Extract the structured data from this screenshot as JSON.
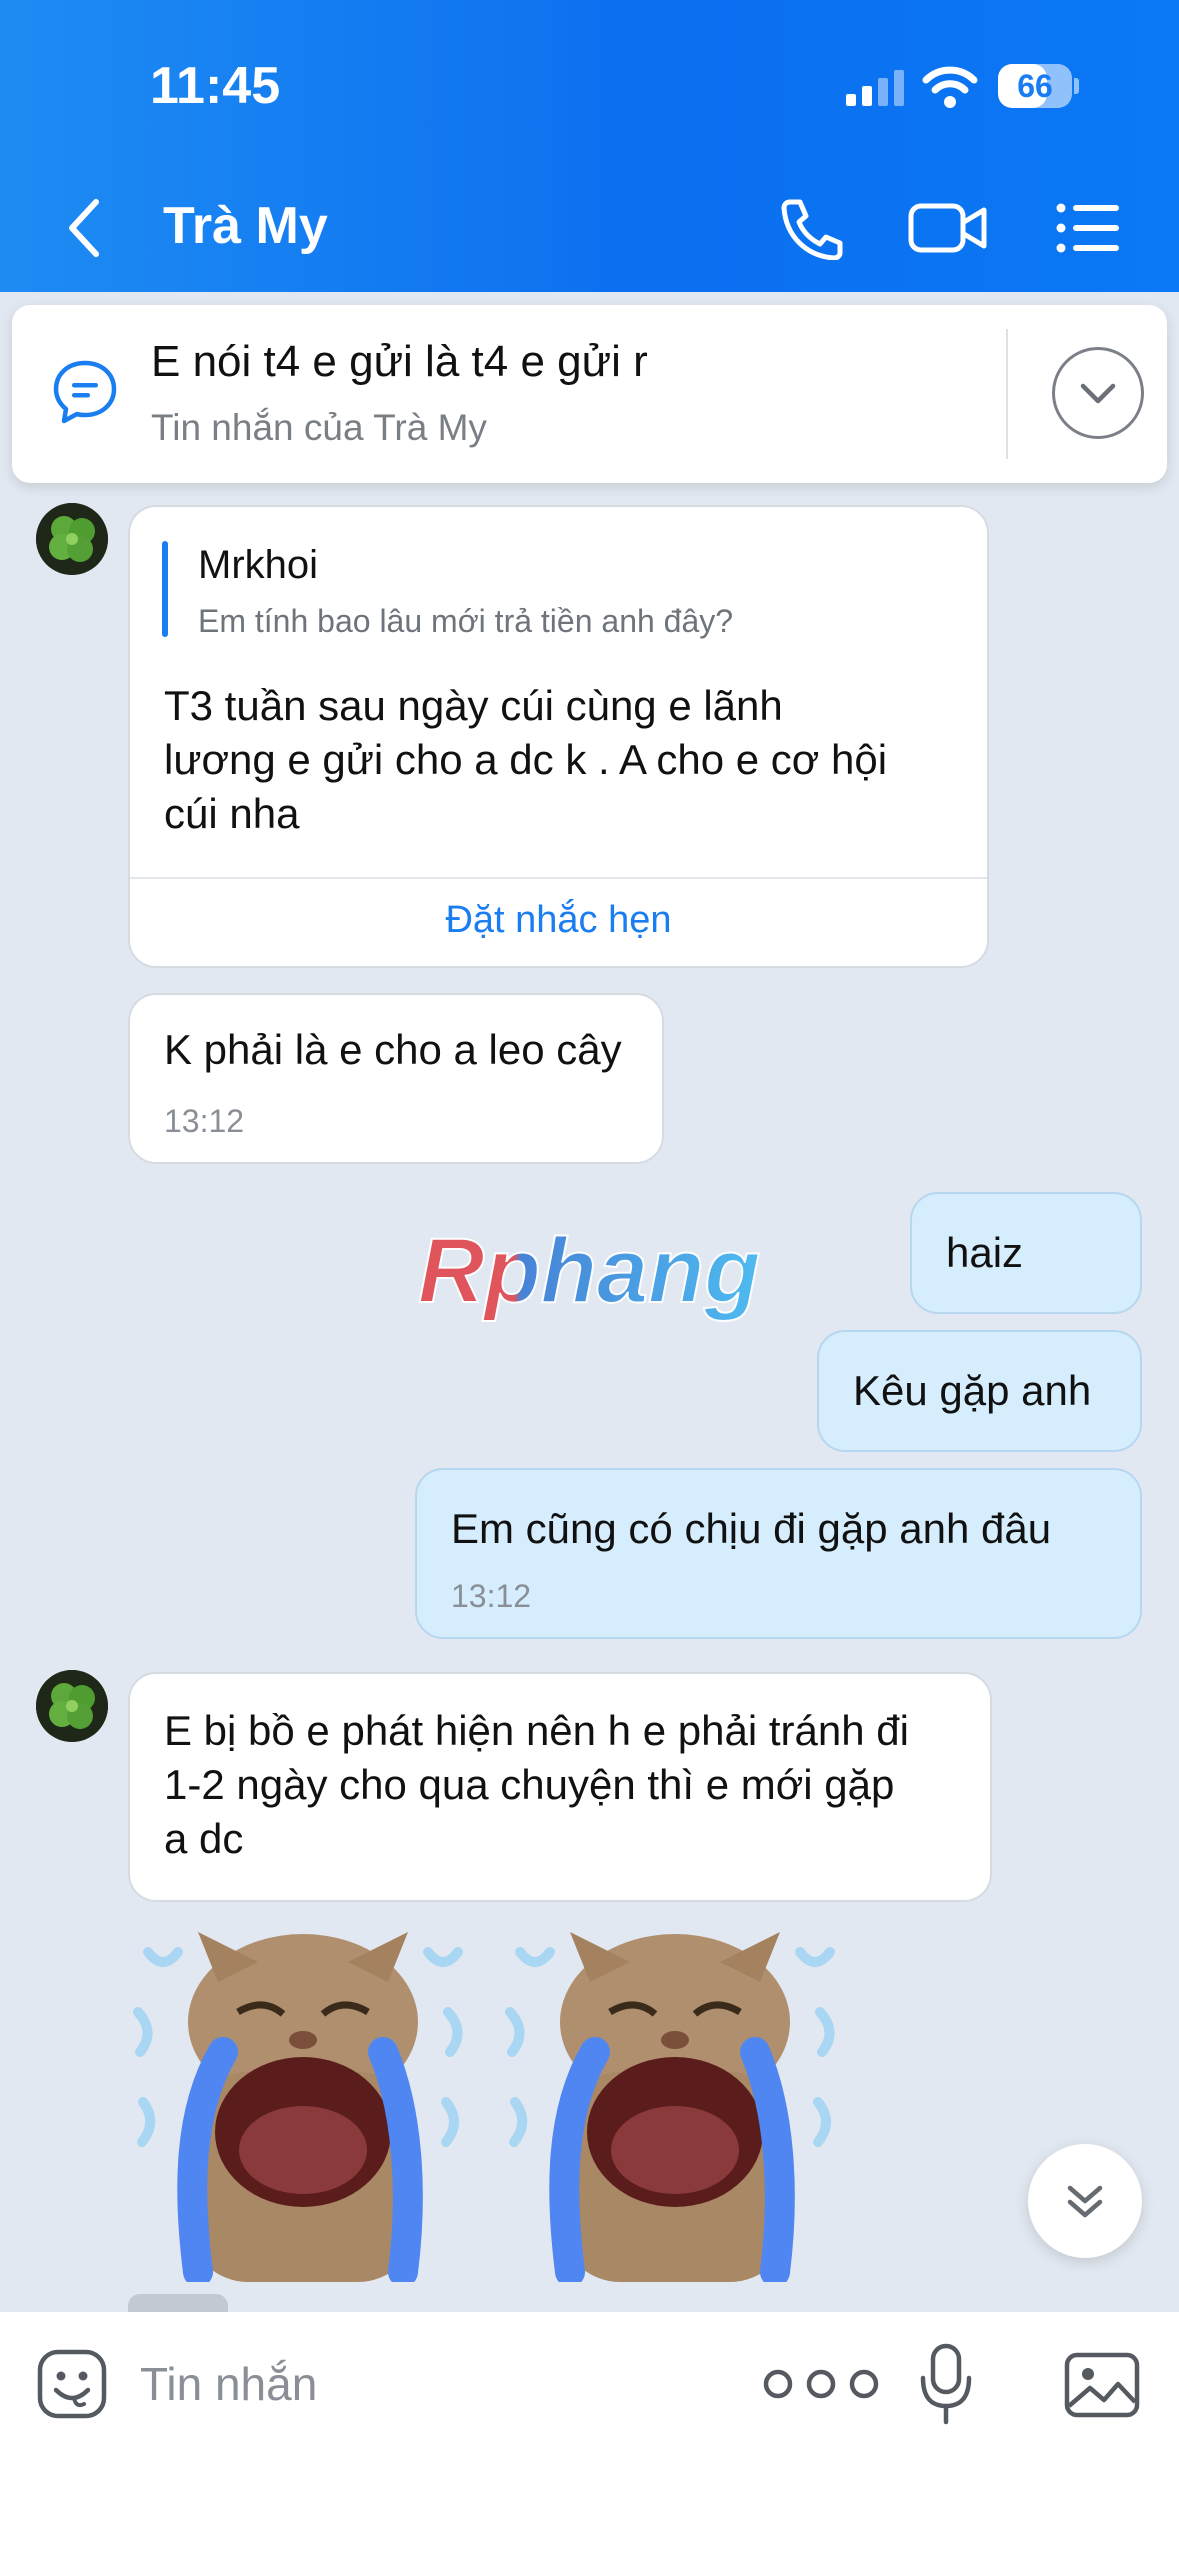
{
  "status_bar": {
    "time": "11:45",
    "battery": "66",
    "battery_level": 0.66
  },
  "header": {
    "contact_name": "Trà My"
  },
  "pinned": {
    "text": "E nói t4 e gửi là t4 e gửi r",
    "subtitle": "Tin nhắn của Trà My"
  },
  "messages": [
    {
      "quote_name": "Mrkhoi",
      "quote_text": "Em tính bao lâu mới trả tiền anh đây?",
      "line1": "T3 tuần sau ngày cúi cùng e lãnh",
      "line2": "lương e gửi cho a dc k . A cho e cơ hội",
      "line3": "cúi nha",
      "reminder": "Đặt nhắc hẹn"
    },
    {
      "text": "K phải là e cho a leo cây",
      "time": "13:12"
    },
    {
      "text": "haiz"
    },
    {
      "text": "Kêu gặp anh"
    },
    {
      "text": "Em cũng có chịu đi gặp anh đâu",
      "time": "13:12"
    },
    {
      "line1": "E bị bồ e phát hiện nên h e phải tránh đi",
      "line2": "1-2 ngày cho qua chuyện thì e mới gặp",
      "line3": "a dc"
    }
  ],
  "watermark": "Rphang",
  "input": {
    "placeholder": "Tin nhắn"
  }
}
